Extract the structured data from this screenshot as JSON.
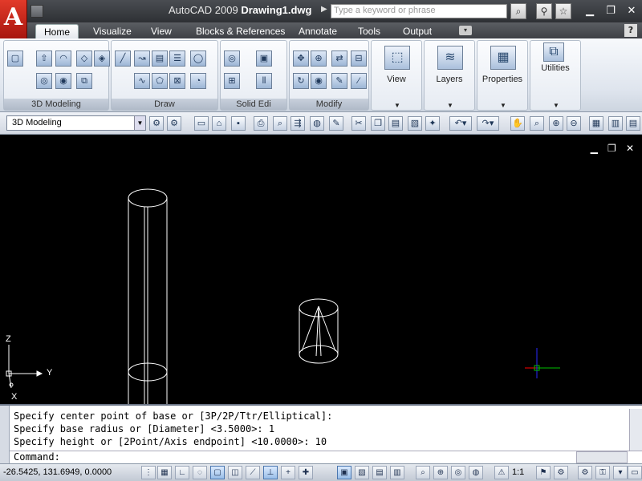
{
  "window": {
    "app_name": "AutoCAD 2009",
    "document_name": "Drawing1.dwg",
    "logo_letter": "A",
    "search_placeholder": "Type a keyword or phrase",
    "minimize": "▁",
    "restore": "❐",
    "close": "✕"
  },
  "tabs": [
    {
      "label": "Home",
      "active": true
    },
    {
      "label": "Visualize"
    },
    {
      "label": "View"
    },
    {
      "label": "Blocks & References"
    },
    {
      "label": "Annotate"
    },
    {
      "label": "Tools"
    },
    {
      "label": "Output"
    }
  ],
  "ribbon": {
    "panels": [
      {
        "label": "3D Modeling"
      },
      {
        "label": "Draw"
      },
      {
        "label": "Solid Edi"
      },
      {
        "label": "Modify"
      }
    ],
    "big_buttons": [
      {
        "label": "View",
        "icon": "cube-icon"
      },
      {
        "label": "Layers",
        "icon": "layers-icon"
      },
      {
        "label": "Properties",
        "icon": "properties-icon"
      },
      {
        "label": "Utilities",
        "icon": "utilities-icon"
      }
    ]
  },
  "toolbar": {
    "workspace": "3D Modeling"
  },
  "command": {
    "history": [
      "Specify center point of base or [3P/2P/Ttr/Elliptical]:",
      "Specify base radius or [Diameter] <3.5000>: 1",
      "Specify height or [2Point/Axis endpoint] <10.0000>: 10"
    ],
    "prompt": "Command:"
  },
  "status": {
    "coordinates": "-26.5425, 131.6949, 0.0000",
    "scale": "1:1"
  },
  "ucs": {
    "x": "X",
    "y": "Y",
    "z": "Z"
  },
  "colors": {
    "canvas": "#000000",
    "entity": "#ffffff",
    "crosshair_x": "#ff0000",
    "crosshair_y": "#00ff00",
    "crosshair_z": "#0000ff"
  }
}
